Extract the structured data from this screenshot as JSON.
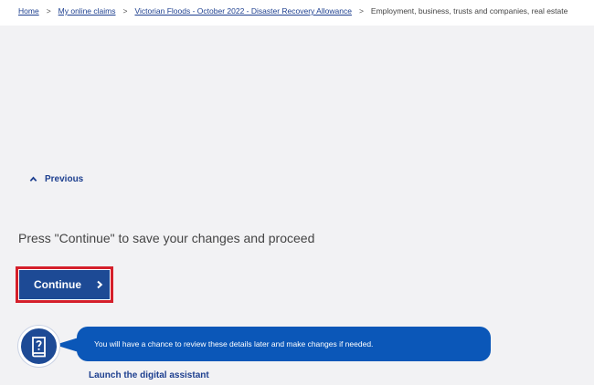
{
  "breadcrumb": {
    "items": [
      {
        "label": "Home",
        "link": true
      },
      {
        "label": "My online claims",
        "link": true
      },
      {
        "label": "Victorian Floods - October 2022 - Disaster Recovery Allowance",
        "link": true
      },
      {
        "label": "Employment, business, trusts and companies, real estate",
        "link": false
      }
    ],
    "separator": ">"
  },
  "navigation": {
    "previous_label": "Previous"
  },
  "main": {
    "instruction": "Press \"Continue\" to save your changes and proceed",
    "continue_label": "Continue"
  },
  "assistant": {
    "message": "You will have a chance to review these details later and make changes if needed.",
    "launch_label": "Launch the digital assistant",
    "icon": "help-book-icon"
  },
  "colors": {
    "brand_blue": "#1d4a95",
    "bubble_blue": "#0b57b8",
    "focus_red": "#d51f2a",
    "link_blue": "#1d3f8f",
    "background": "#f2f2f4"
  }
}
